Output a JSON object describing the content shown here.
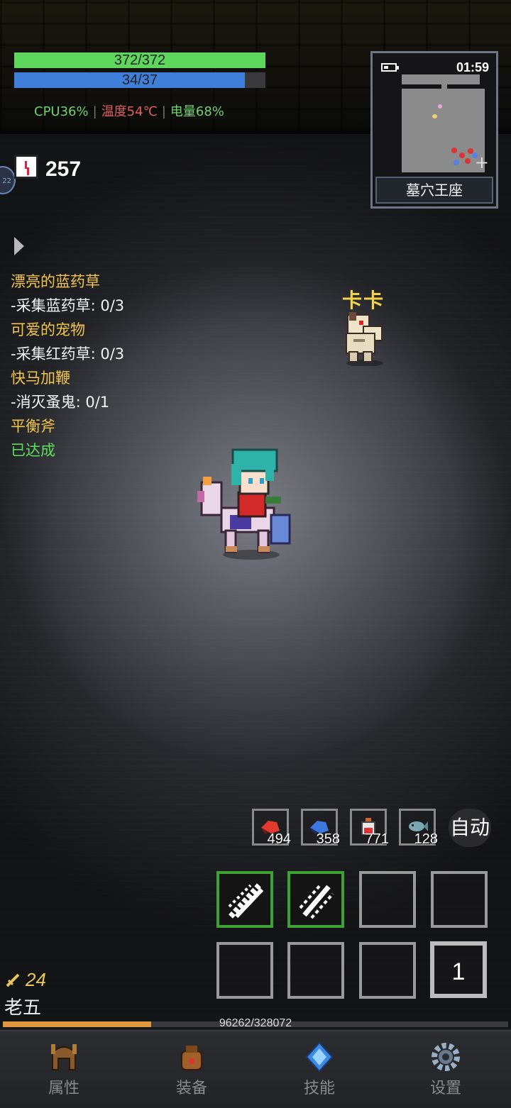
{
  "hud": {
    "hp": {
      "text": "372/372",
      "ratio": 1.0
    },
    "mp": {
      "text": "34/37",
      "ratio": 0.919
    },
    "cpu": "CPU36%",
    "temp": "温度54℃",
    "battery": "电量68%",
    "colors": {
      "cpu": "#6fd46a",
      "temp": "#e0605a",
      "battery": "#6fd46a"
    }
  },
  "timer": {
    "icon": "clock-icon",
    "value": "257"
  },
  "side_badge": "22",
  "quests": [
    {
      "title": "漂亮的蓝药草",
      "detail": "-采集蓝药草: 0/3",
      "done": false
    },
    {
      "title": "可爱的宠物",
      "detail": "-采集红药草: 0/3",
      "done": false
    },
    {
      "title": "快马加鞭",
      "detail": "-消灭蚤鬼: 0/1",
      "done": false
    },
    {
      "title": "平衡斧",
      "detail": "已达成",
      "done": true
    }
  ],
  "minimap": {
    "time": "01:59",
    "location": "墓穴王座",
    "battery_icon": "battery-icon",
    "plus": "+"
  },
  "npc": {
    "name": "卡卡"
  },
  "potions": [
    {
      "icon": "red-herb-icon",
      "count": "494",
      "color": "#e23b2e"
    },
    {
      "icon": "blue-herb-icon",
      "count": "358",
      "color": "#3b78e0"
    },
    {
      "icon": "potion-bottle-icon",
      "count": "771",
      "color": "#d8d8d8"
    },
    {
      "icon": "fish-icon",
      "count": "128",
      "color": "#7aa7b0"
    }
  ],
  "auto_label": "自动",
  "skills": {
    "count_slot": "1"
  },
  "player": {
    "level": "24",
    "name": "老五",
    "xp_text": "96262/328072",
    "xp_ratio": 0.293
  },
  "nav": [
    {
      "label": "属性",
      "icon": "helmet-icon"
    },
    {
      "label": "装备",
      "icon": "bag-icon"
    },
    {
      "label": "技能",
      "icon": "crystal-icon"
    },
    {
      "label": "设置",
      "icon": "gear-icon"
    }
  ]
}
